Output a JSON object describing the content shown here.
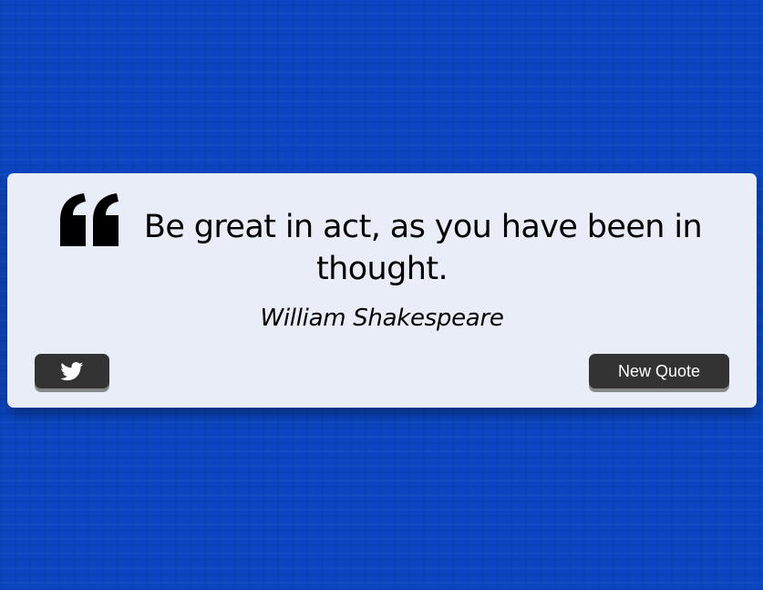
{
  "quote": {
    "text": "Be great in act, as you have been in thought.",
    "author": "William Shakespeare"
  },
  "buttons": {
    "tweet_icon": "twitter-icon",
    "new_quote_label": "New Quote"
  },
  "colors": {
    "background": "#0a46c2",
    "card": "#e8edf8",
    "button": "#333333",
    "button_text": "#ffffff",
    "text": "#000000"
  }
}
